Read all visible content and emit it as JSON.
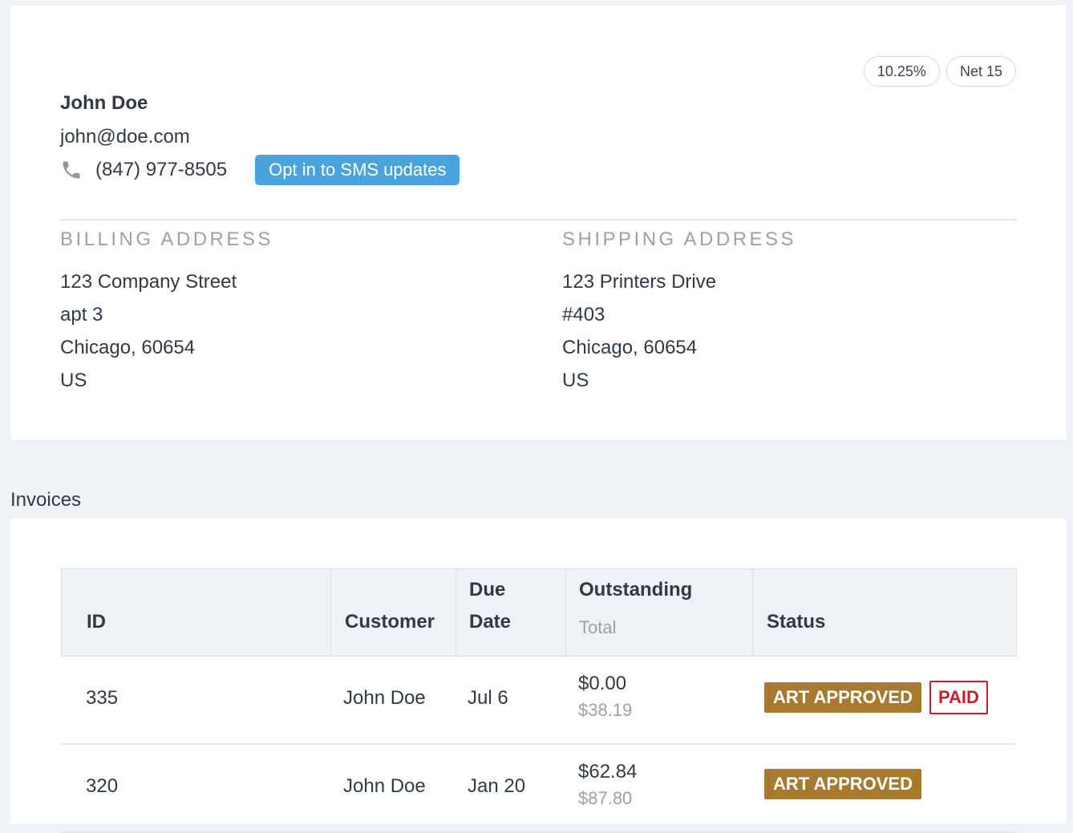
{
  "customer": {
    "name": "John Doe",
    "email": "john@doe.com",
    "phone": "(847) 977-8505",
    "sms_button": "Opt in to SMS updates",
    "tax_rate": "10.25%",
    "terms": "Net 15",
    "billing": {
      "heading": "BILLING ADDRESS",
      "lines": [
        "123 Company Street",
        "apt 3",
        "Chicago, 60654",
        "US"
      ]
    },
    "shipping": {
      "heading": "SHIPPING ADDRESS",
      "lines": [
        "123 Printers Drive",
        "#403",
        "Chicago, 60654",
        "US"
      ]
    }
  },
  "invoices": {
    "title": "Invoices",
    "columns": {
      "id": "ID",
      "customer": "Customer",
      "due_date_1": "Due",
      "due_date_2": "Date",
      "outstanding": "Outstanding",
      "total": "Total",
      "status": "Status"
    },
    "rows": [
      {
        "id": "335",
        "customer": "John Doe",
        "due": "Jul 6",
        "outstanding": "$0.00",
        "total": "$38.19",
        "badge_art": "ART APPROVED",
        "badge_paid": "PAID"
      },
      {
        "id": "320",
        "customer": "John Doe",
        "due": "Jan 20",
        "outstanding": "$62.84",
        "total": "$87.80",
        "badge_art": "ART APPROVED"
      }
    ]
  },
  "icons": {
    "phone": "phone-icon"
  },
  "colors": {
    "accent": "#4aa3dd",
    "art_approved": "#a87a30",
    "paid": "#c8202a",
    "background": "#eff2f7"
  }
}
